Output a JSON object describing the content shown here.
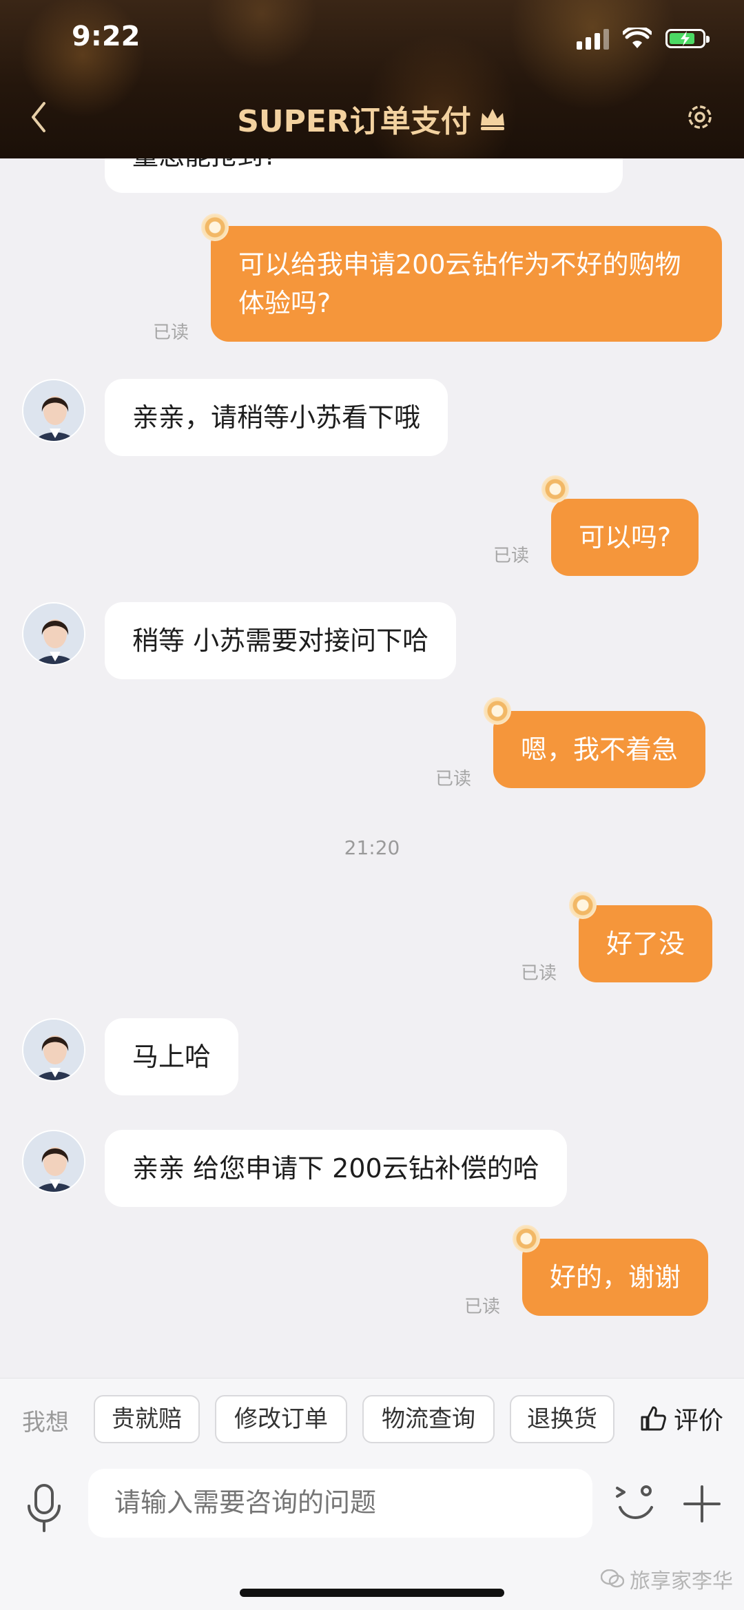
{
  "status": {
    "time": "9:22"
  },
  "header": {
    "title": "SUPER订单支付"
  },
  "chat": {
    "partial_top_text": "量怎能抢到?",
    "messages": [
      {
        "side": "right",
        "text": "可以给我申请200云钻作为不好的购物体验吗?",
        "status": "已读"
      },
      {
        "side": "left",
        "text": "亲亲，请稍等小苏看下哦"
      },
      {
        "side": "right",
        "text": "可以吗?",
        "status": "已读"
      },
      {
        "side": "left",
        "text": "稍等 小苏需要对接问下哈"
      },
      {
        "side": "right",
        "text": "嗯，我不着急",
        "status": "已读"
      },
      {
        "side": "right",
        "text": "好了没",
        "status": "已读"
      },
      {
        "side": "left",
        "text": "马上哈"
      },
      {
        "side": "left",
        "text": "亲亲 给您申请下 200云钻补偿的哈"
      },
      {
        "side": "right",
        "text": "好的，谢谢",
        "status": "已读"
      }
    ],
    "timestamp": "21:20"
  },
  "quickbar": {
    "label": "我想",
    "chips": [
      "贵就赔",
      "修改订单",
      "物流查询",
      "退换货"
    ],
    "rate_label": "评价"
  },
  "input": {
    "placeholder": "请输入需要咨询的问题"
  },
  "watermark": "旅享家李华"
}
